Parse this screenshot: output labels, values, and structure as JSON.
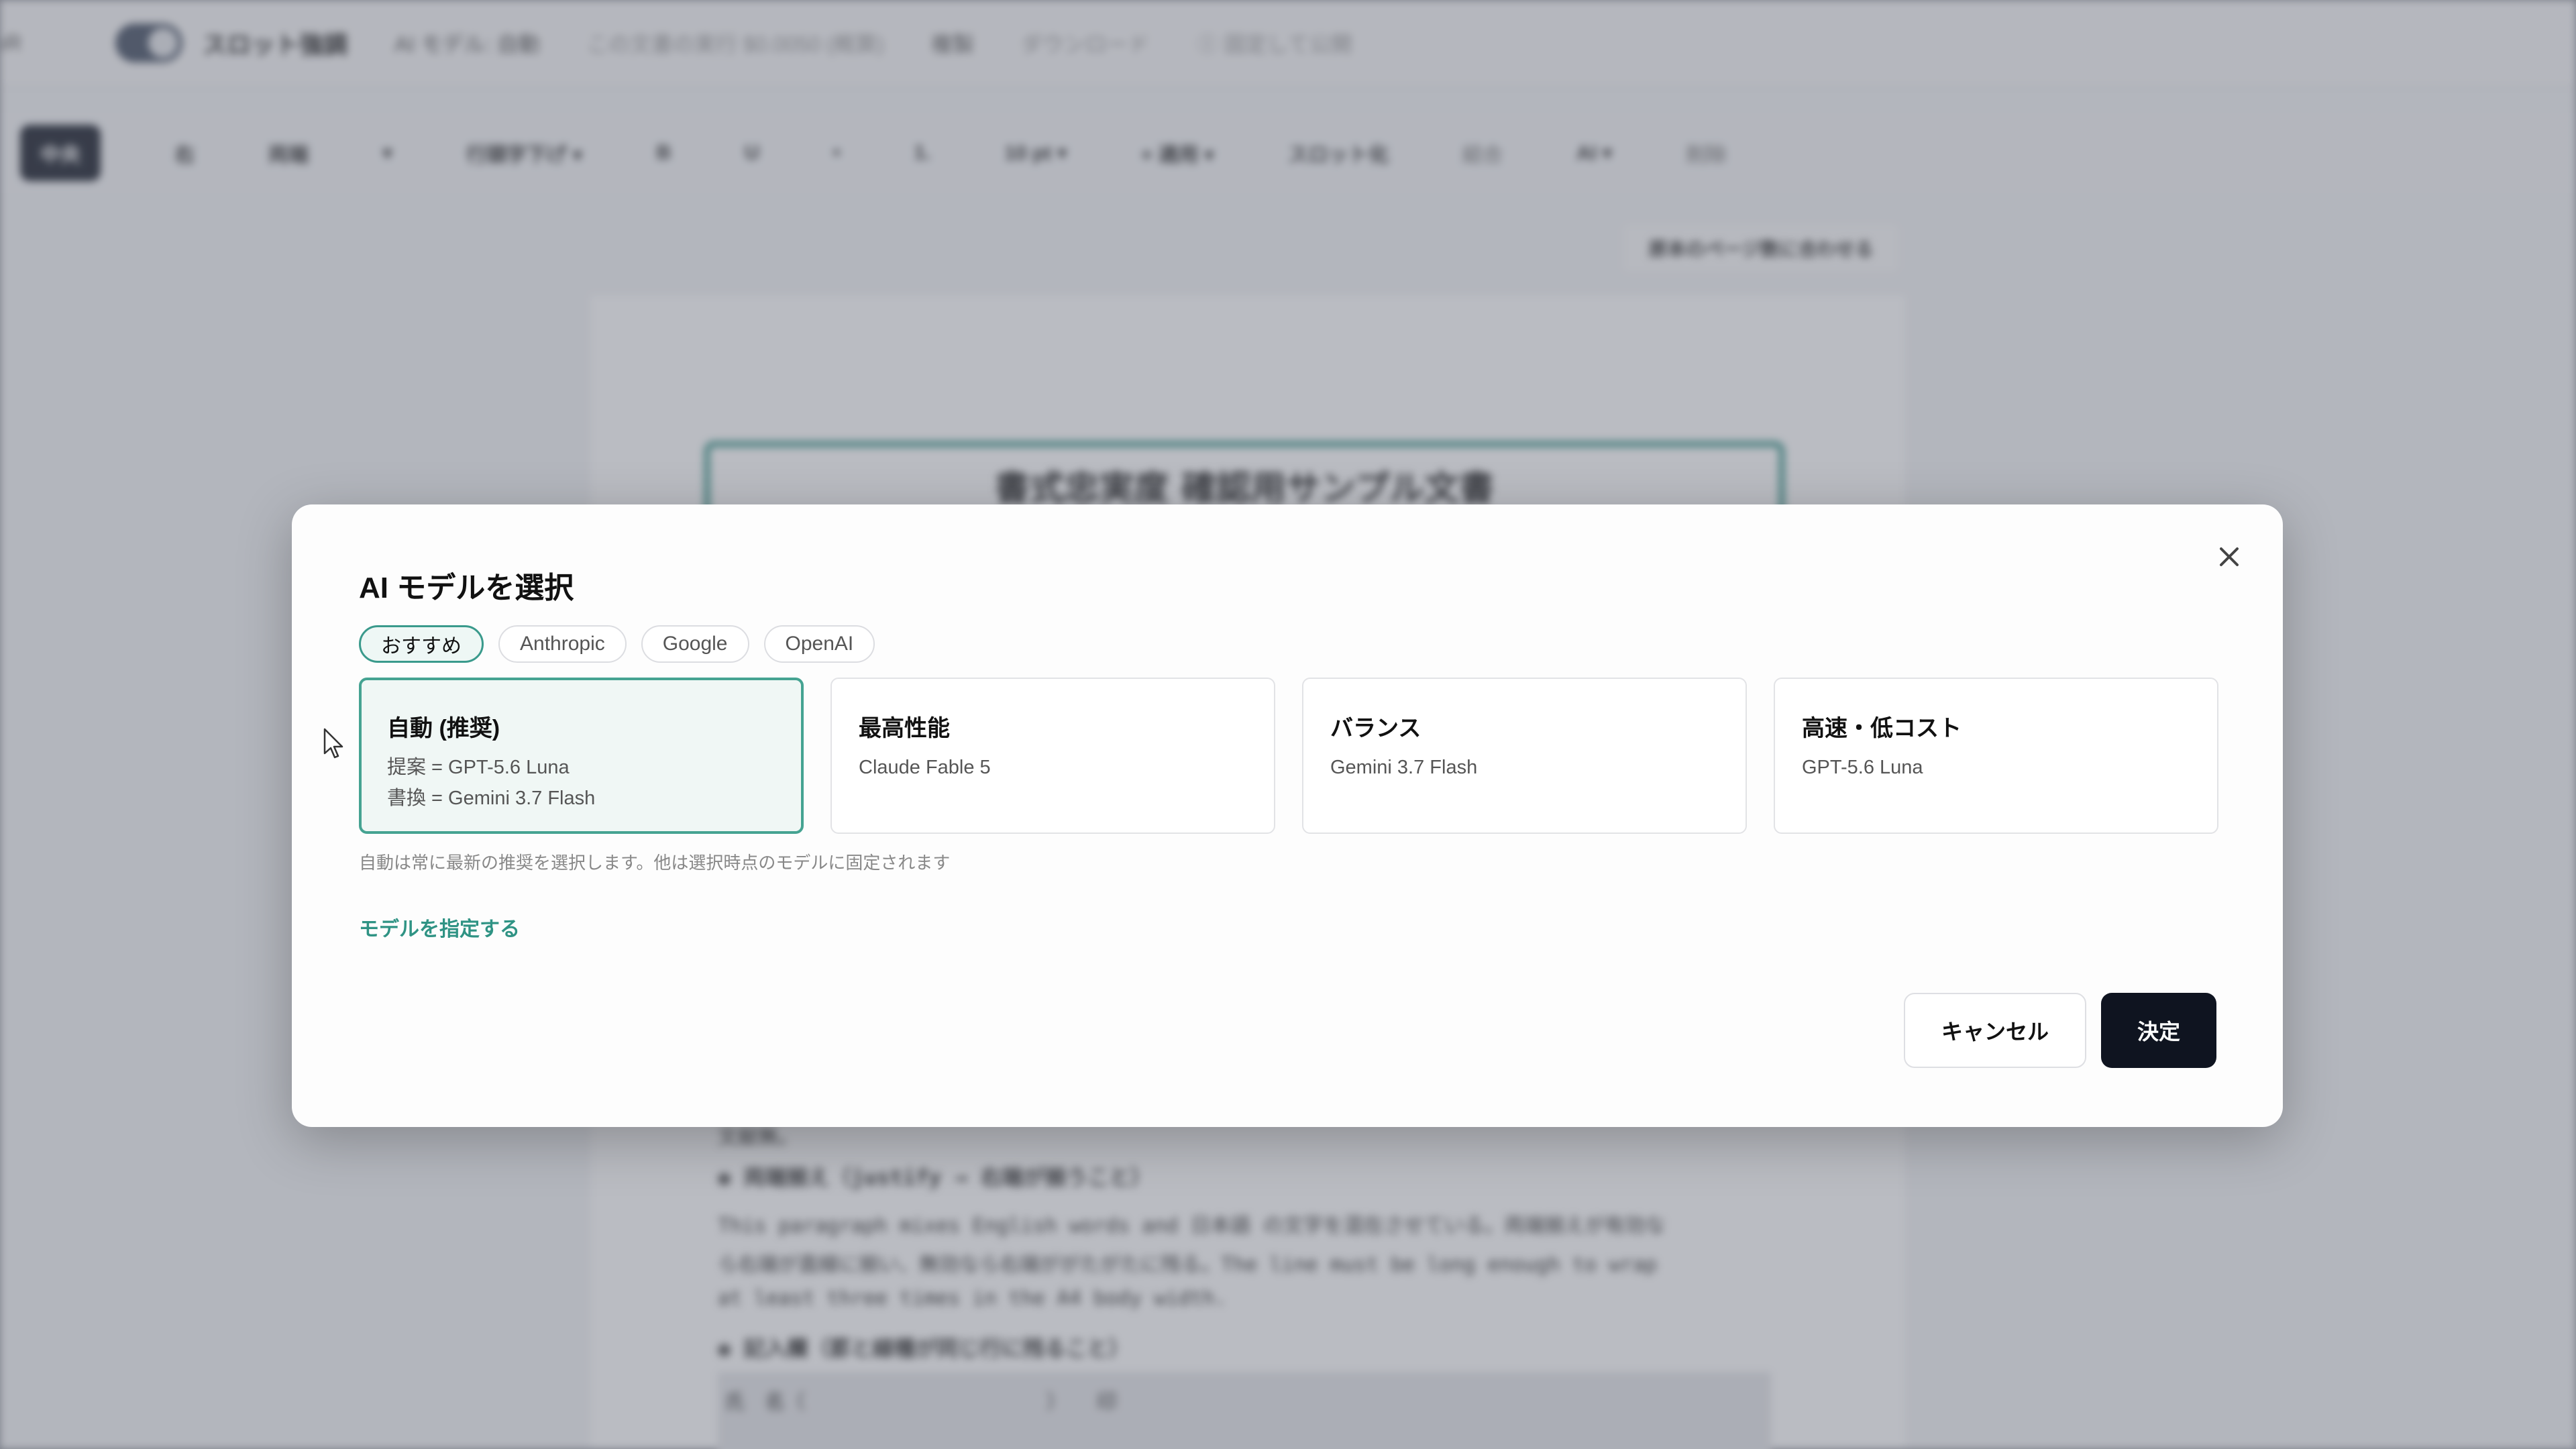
{
  "background_app": {
    "topbar": {
      "left_fragment": "ıR",
      "slot_toggle_label": "スロット強調",
      "ai_model": "AI モデル: 自動",
      "cost_estimate": "この文書の実行 $0.0050 (概算)",
      "duplicate": "複製",
      "download": "ダウンロード",
      "publish": "Ⓘ 固定して公開"
    },
    "toolbar": {
      "align_center": "中央",
      "align_right": "右",
      "justify": "両端",
      "heading_dropdown": "▾",
      "indent_dropdown": "行頭字下げ ▾",
      "bold": "B",
      "underline": "U",
      "dot": "•",
      "list_item": "1.",
      "font_size": "10 pt ▾",
      "apply": "+ 適用 ▾",
      "slotify": "スロット化",
      "merge": "結合",
      "ai": "AI ▾",
      "delete": "削除"
    },
    "fit_pages_button": "原本のページ数に合わせる",
    "document": {
      "title": "書式忠実度 確認用サンプル文書",
      "line_fragment": "文献無。",
      "heading_justify": "◉ 両端揃え（justify → 右端が揃うこと）",
      "paragraph": [
        "This paragraph mixes English words and 日本語 の文字を混在させている。両端揃えが有効な",
        "ら右端が直線に揃い、無効なら右端ががたがたに残る。The line must be long enough to wrap",
        "at least three times in the A4 body width."
      ],
      "heading_form": "◉ 記入欄（罫と線種が同じ行に残ること）",
      "form_row": "氏　名（　　　　　　　　　　　　）　　印"
    }
  },
  "modal": {
    "title": "AI モデルを選択",
    "tabs": [
      {
        "label": "おすすめ",
        "active": true
      },
      {
        "label": "Anthropic",
        "active": false
      },
      {
        "label": "Google",
        "active": false
      },
      {
        "label": "OpenAI",
        "active": false
      }
    ],
    "cards": [
      {
        "title": "自動 (推奨)",
        "lines": [
          "提案 = GPT-5.6 Luna",
          "書換 = Gemini 3.7 Flash"
        ],
        "selected": true
      },
      {
        "title": "最高性能",
        "lines": [
          "Claude Fable 5"
        ],
        "selected": false
      },
      {
        "title": "バランス",
        "lines": [
          "Gemini 3.7 Flash"
        ],
        "selected": false
      },
      {
        "title": "高速・低コスト",
        "lines": [
          "GPT-5.6 Luna"
        ],
        "selected": false
      }
    ],
    "hint": "自動は常に最新の推奨を選択します。他は選択時点のモデルに固定されます",
    "specify_link": "モデルを指定する",
    "cancel_label": "キャンセル",
    "confirm_label": "決定"
  },
  "colors": {
    "accent": "#3a9a8c",
    "primary_button": "#0f1420",
    "overlay": "rgba(90,95,110,0.42)"
  },
  "icons": {
    "close": "close-icon",
    "cursor": "mouse-pointer-icon"
  }
}
